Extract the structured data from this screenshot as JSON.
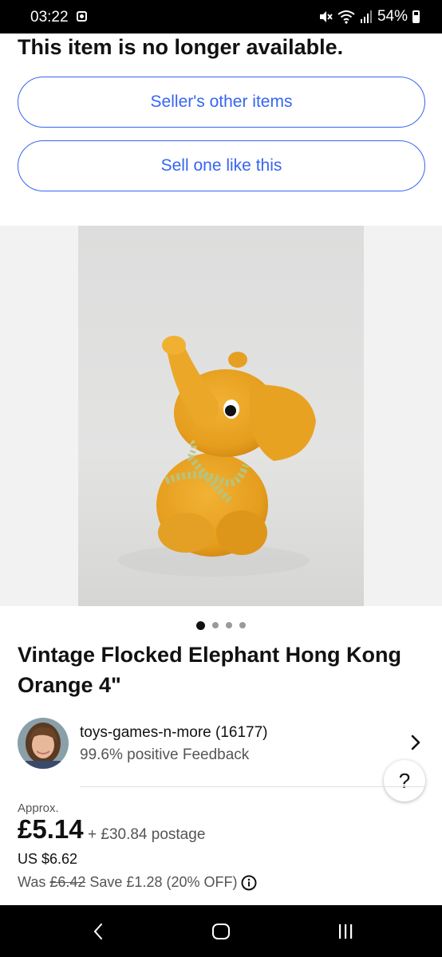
{
  "status_bar": {
    "time": "03:22",
    "battery": "54%",
    "icons": [
      "notification-icon",
      "mute-icon",
      "wifi-icon",
      "signal-icon",
      "battery-icon"
    ]
  },
  "notice": "This item is no longer available.",
  "buttons": {
    "seller_other": "Seller's other items",
    "sell_one": "Sell one like this"
  },
  "gallery": {
    "image": "orange-flocked-elephant-photo",
    "page_count": 4,
    "active_page": 1
  },
  "listing": {
    "title": "Vintage Flocked Elephant Hong Kong Orange 4\""
  },
  "seller": {
    "name": "toys-games-n-more (16177)",
    "feedback": "99.6% positive Feedback"
  },
  "help": {
    "label": "?"
  },
  "pricing": {
    "approx_label": "Approx.",
    "price": "£5.14",
    "postage": "+ £30.84 postage",
    "usd": "US $6.62",
    "was_label": "Was",
    "was_price": "£6.42",
    "savings": "Save £1.28 (20% OFF)"
  },
  "nav": [
    "back-icon",
    "home-icon",
    "recents-icon"
  ],
  "colors": {
    "accent": "#3665f3",
    "product": "#e8a020"
  }
}
